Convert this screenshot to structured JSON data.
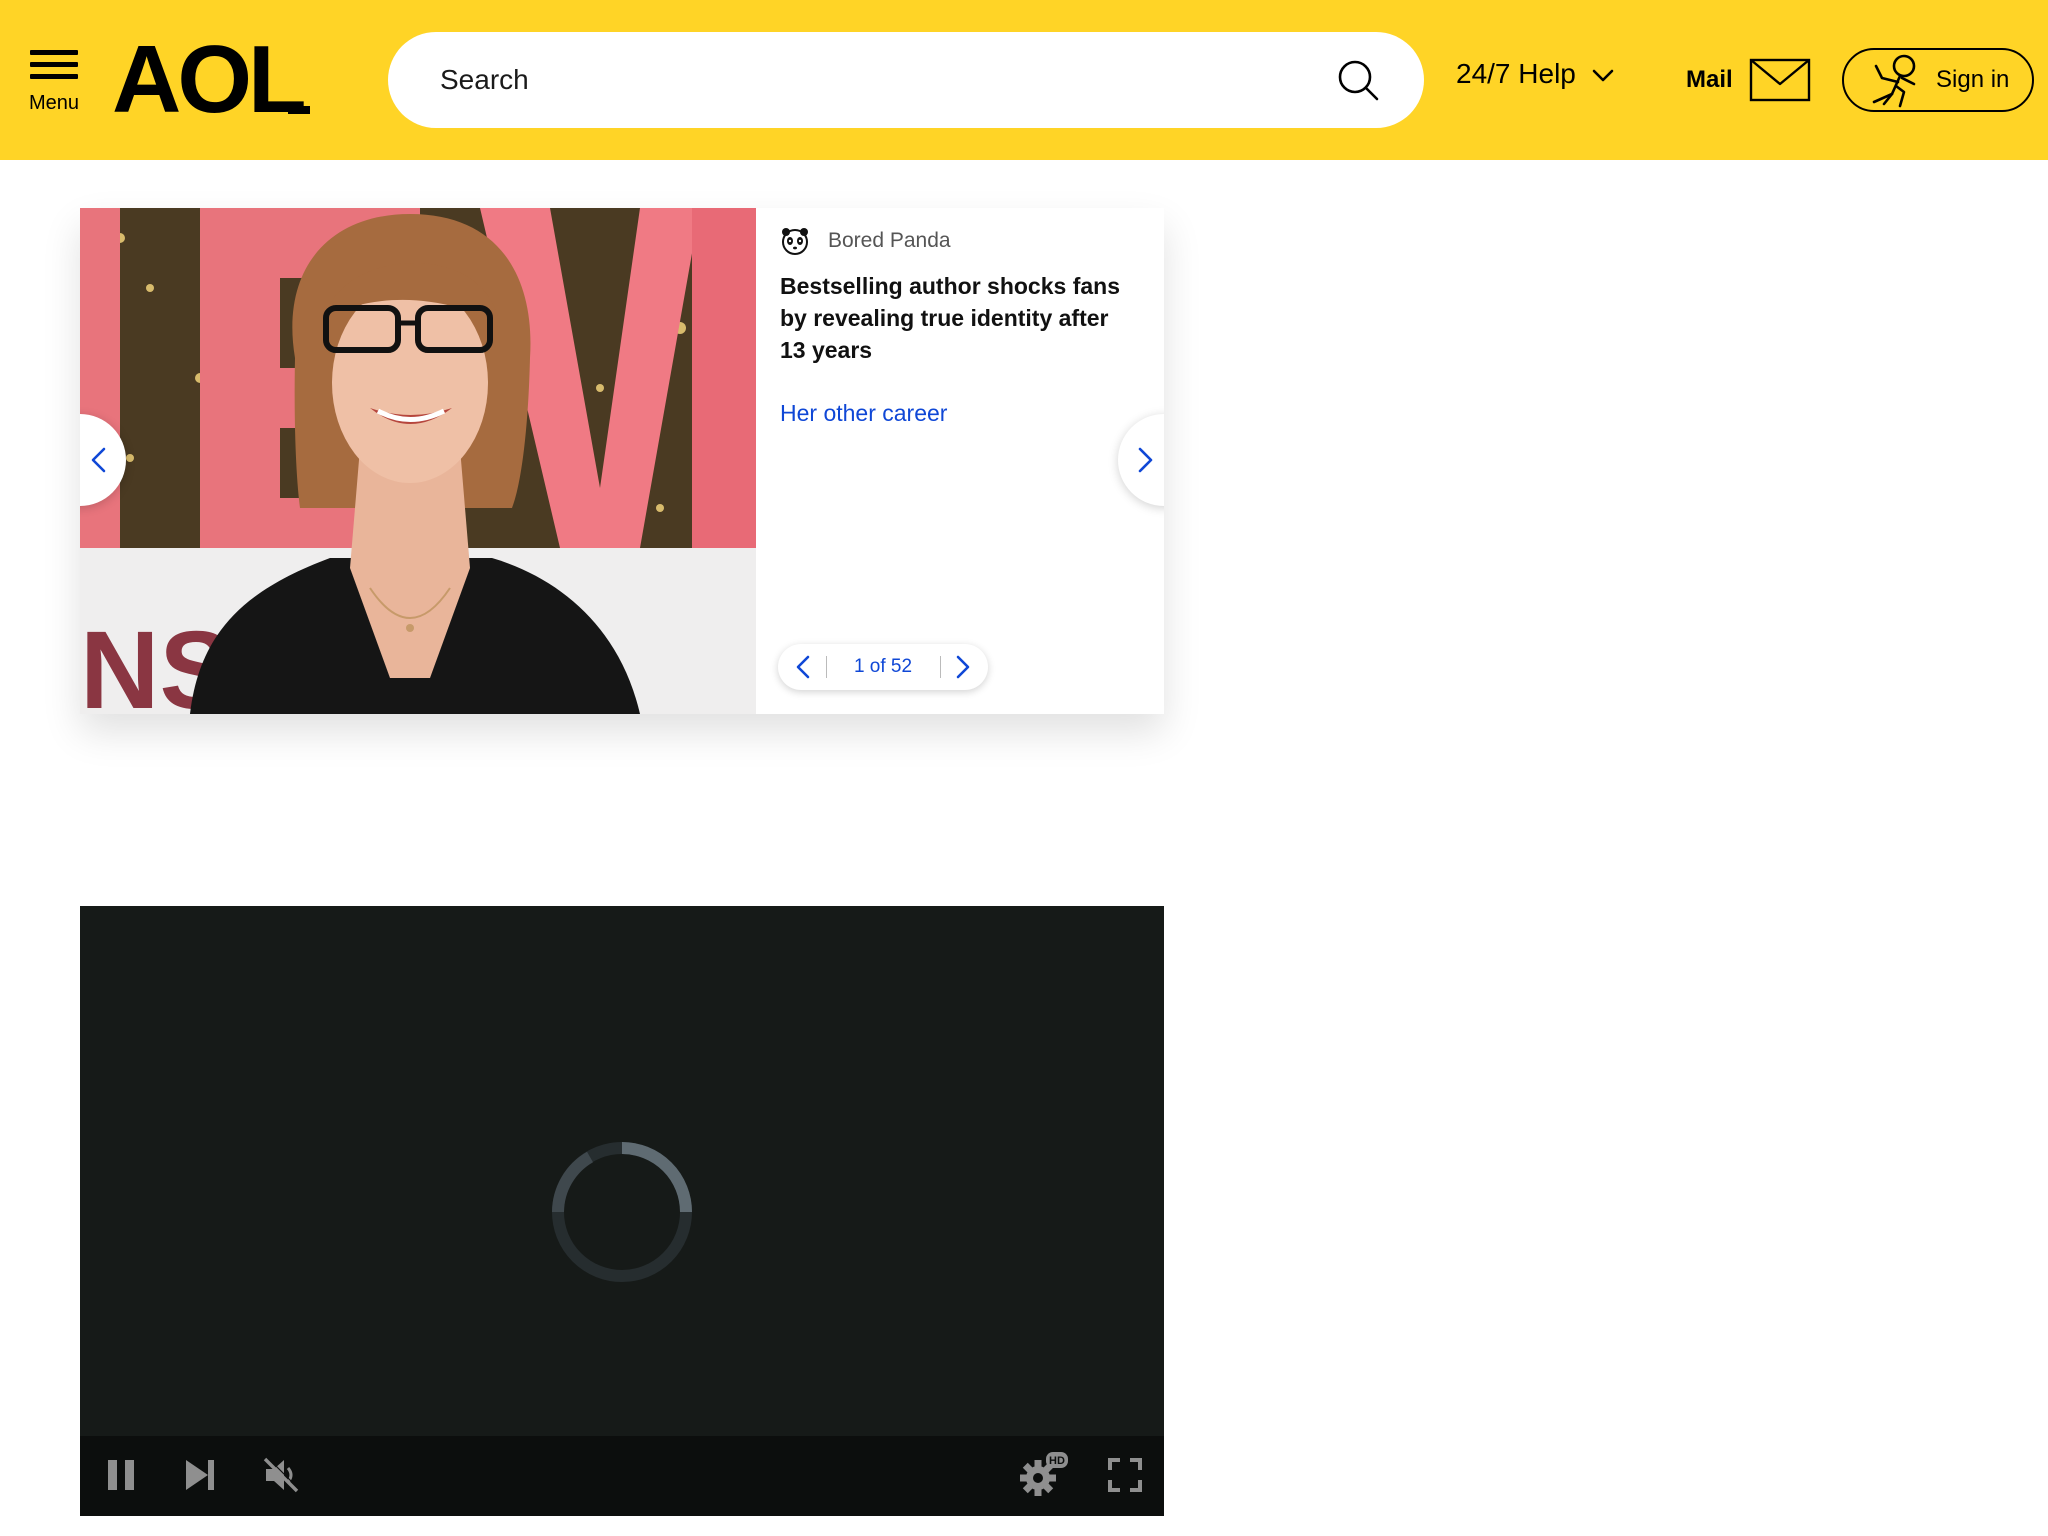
{
  "header": {
    "menu_label": "Menu",
    "logo_text": "AOL",
    "search_placeholder": "Search",
    "help_label": "24/7 Help",
    "mail_label": "Mail",
    "signin_label": "Sign in",
    "background_color": "#ffd426"
  },
  "slideshow": {
    "source_name": "Bored Panda",
    "source_icon": "panda-icon",
    "headline": "Bestselling author shocks fans by revealing true identity after 13 years",
    "cta_label": "Her other career",
    "pager_current": 1,
    "pager_total": 52,
    "pager_label": "1 of 52",
    "image_backdrop_letters": "NS",
    "link_color": "#0f47d6"
  },
  "video": {
    "state": "loading",
    "hd_badge": "HD",
    "background_color": "#161a18",
    "controls": [
      "pause-icon",
      "next-icon",
      "mute-icon",
      "gear-icon",
      "fullscreen-icon"
    ]
  }
}
